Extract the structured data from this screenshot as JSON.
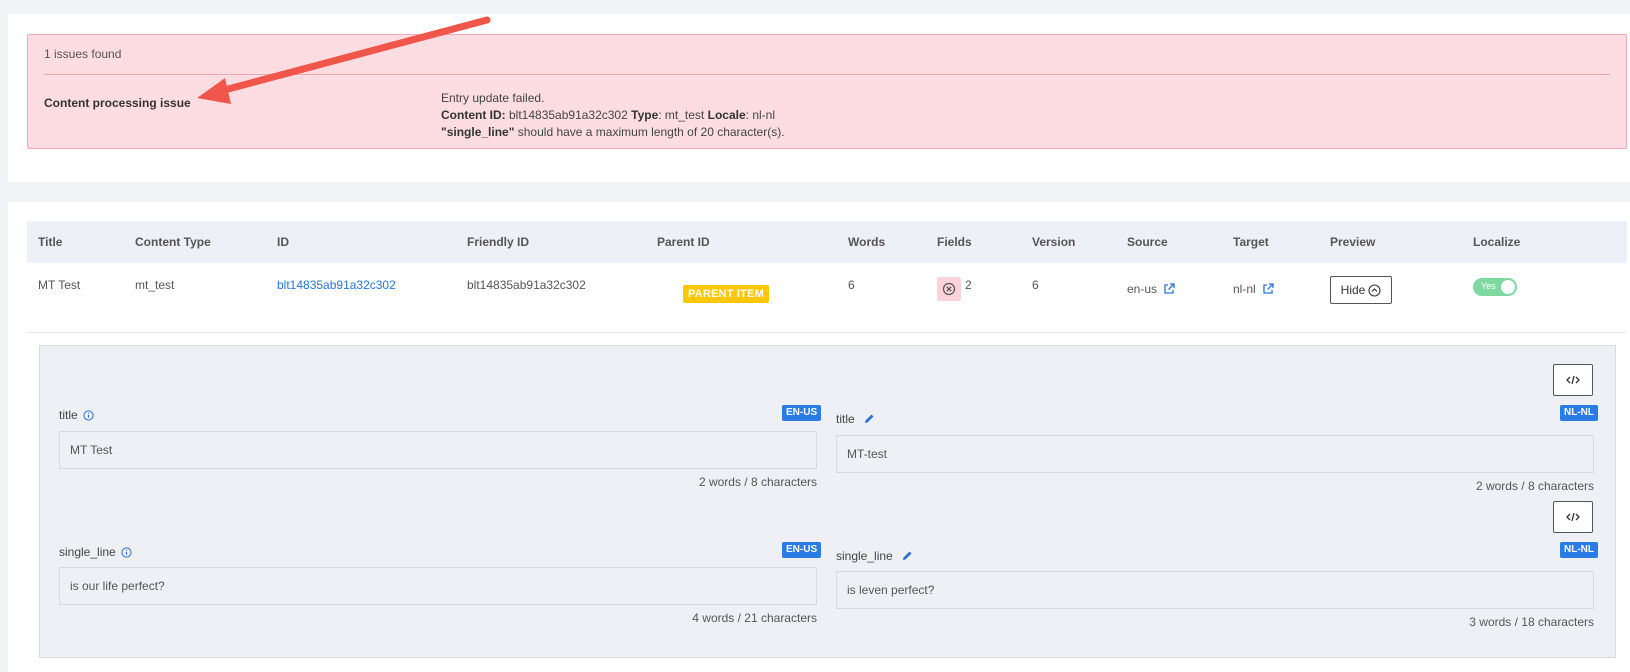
{
  "issues": {
    "count_text": "1 issues found",
    "title": "Content processing issue",
    "message": "Entry update failed.",
    "content_id_label": "Content ID:",
    "content_id": "blt14835ab91a32c302",
    "type_label": "Type",
    "type": "mt_test",
    "locale_label": "Locale",
    "locale": "nl-nl",
    "field_name": "\"single_line\"",
    "field_error": "should have a maximum length of 20 character(s)."
  },
  "table": {
    "headers": [
      "Title",
      "Content Type",
      "ID",
      "Friendly ID",
      "Parent ID",
      "Words",
      "Fields",
      "Version",
      "Source",
      "Target",
      "Preview",
      "Localize"
    ],
    "row": {
      "title": "MT Test",
      "content_type": "mt_test",
      "id": "blt14835ab91a32c302",
      "friendly_id": "blt14835ab91a32c302",
      "parent_badge": "PARENT ITEM",
      "words": "6",
      "fields": "2",
      "version": "6",
      "source": "en-us",
      "target": "nl-nl",
      "preview_button": "Hide",
      "localize_toggle": "Yes"
    }
  },
  "preview": {
    "fields": [
      {
        "source": {
          "label": "title",
          "locale": "EN-US",
          "value": "MT Test",
          "count": "2 words / 8 characters"
        },
        "target": {
          "label": "title",
          "locale": "NL-NL",
          "value": "MT-test",
          "count": "2 words / 8 characters"
        }
      },
      {
        "source": {
          "label": "single_line",
          "locale": "EN-US",
          "value": "is our life perfect?",
          "count": "4 words / 21 characters"
        },
        "target": {
          "label": "single_line",
          "locale": "NL-NL",
          "value": "is leven perfect?",
          "count": "3 words / 18 characters"
        }
      }
    ]
  },
  "colors": {
    "alert_bg": "#fddde2",
    "link": "#2a73d9",
    "badge_parent": "#ffc700",
    "locale_badge": "#2a7be4",
    "toggle_on": "#7fd8a0",
    "arrow": "#f0564a"
  },
  "icons": [
    "arrow-annotation-icon",
    "error-circle-icon",
    "external-link-icon",
    "chevron-up-circle-icon",
    "info-icon",
    "pencil-icon",
    "code-icon"
  ]
}
